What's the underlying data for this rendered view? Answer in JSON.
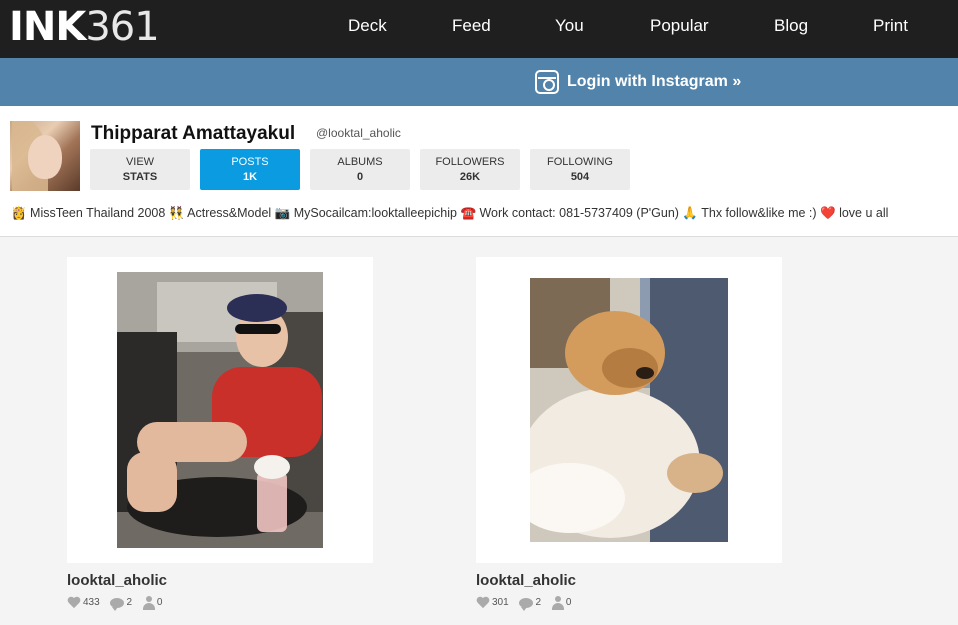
{
  "nav": {
    "logo_bold": "INK",
    "logo_light": "361",
    "items": [
      {
        "label": "Deck"
      },
      {
        "label": "Feed"
      },
      {
        "label": "You"
      },
      {
        "label": "Popular"
      },
      {
        "label": "Blog"
      },
      {
        "label": "Print"
      }
    ]
  },
  "login": {
    "label": "Login with Instagram »",
    "icon": "instagram-icon"
  },
  "profile": {
    "name": "Thipparat Amattayakul",
    "handle": "@looktal_aholic",
    "bio": "👸 MissTeen Thailand 2008 👯 Actress&Model 📷 MySocailcam:looktalleepichip ☎️ Work contact: 081-5737409 (P'Gun) 🙏 Thx follow&like me :) ❤️ love u all"
  },
  "stats": [
    {
      "label": "VIEW",
      "value": "STATS",
      "active": false
    },
    {
      "label": "POSTS",
      "value": "1K",
      "active": true
    },
    {
      "label": "ALBUMS",
      "value": "0",
      "active": false
    },
    {
      "label": "FOLLOWERS",
      "value": "26K",
      "active": false
    },
    {
      "label": "FOLLOWING",
      "value": "504",
      "active": false
    }
  ],
  "posts": [
    {
      "user": "looktal_aholic",
      "likes": "433",
      "comments": "2",
      "tags": "0"
    },
    {
      "user": "looktal_aholic",
      "likes": "301",
      "comments": "2",
      "tags": "0"
    }
  ],
  "colors": {
    "topbar": "#1f1f1f",
    "loginbar": "#5283aa",
    "active_stat": "#0a9be0"
  }
}
